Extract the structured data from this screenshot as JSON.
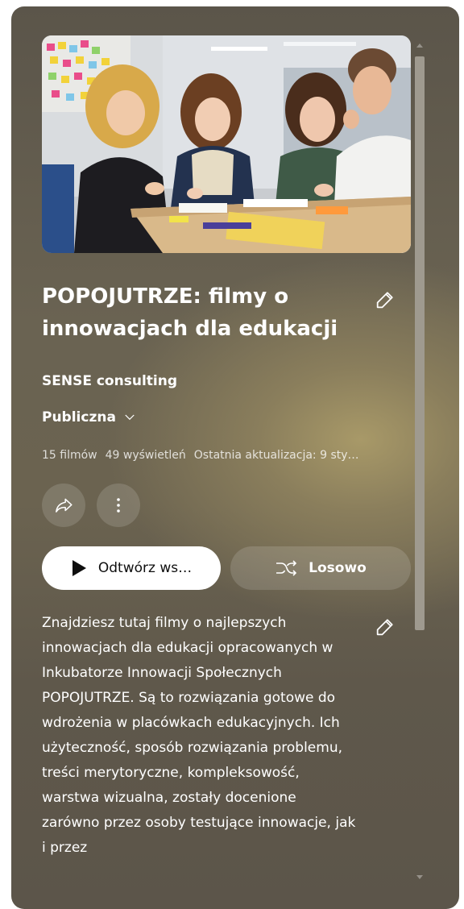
{
  "playlist": {
    "title": "POPOJUTRZE: filmy o innowacjach dla edukacji",
    "owner": "SENSE consulting",
    "privacy": "Publiczna",
    "stats": {
      "videos": "15 filmów",
      "views": "49 wyświetleń",
      "updated": "Ostatnia aktualizacja: 9 sty…"
    },
    "description": "Znajdziesz tutaj filmy o najlepszych innowacjach dla edukacji opracowanych w Inkubatorze Innowacji Społecznych POPOJUTRZE. Są to rozwiązania gotowe do wdrożenia w placówkach edukacyjnych. Ich użyteczność, sposób rozwiązania problemu, treści merytoryczne, kompleksowość, warstwa wizualna, zostały docenione zarówno przez osoby testujące innowacje, jak i przez"
  },
  "actions": {
    "play_all": "Odtwórz ws…",
    "shuffle": "Losowo"
  },
  "icons": {
    "edit": "pencil-icon",
    "privacy_dropdown": "chevron-down-icon",
    "share": "share-arrow-icon",
    "more": "vertical-dots-icon",
    "play": "play-icon",
    "shuffle": "shuffle-icon"
  },
  "colors": {
    "card_bg": "#5f584b",
    "accent_glow": "#a89968",
    "play_button_bg": "#ffffff",
    "text": "#ffffff"
  }
}
